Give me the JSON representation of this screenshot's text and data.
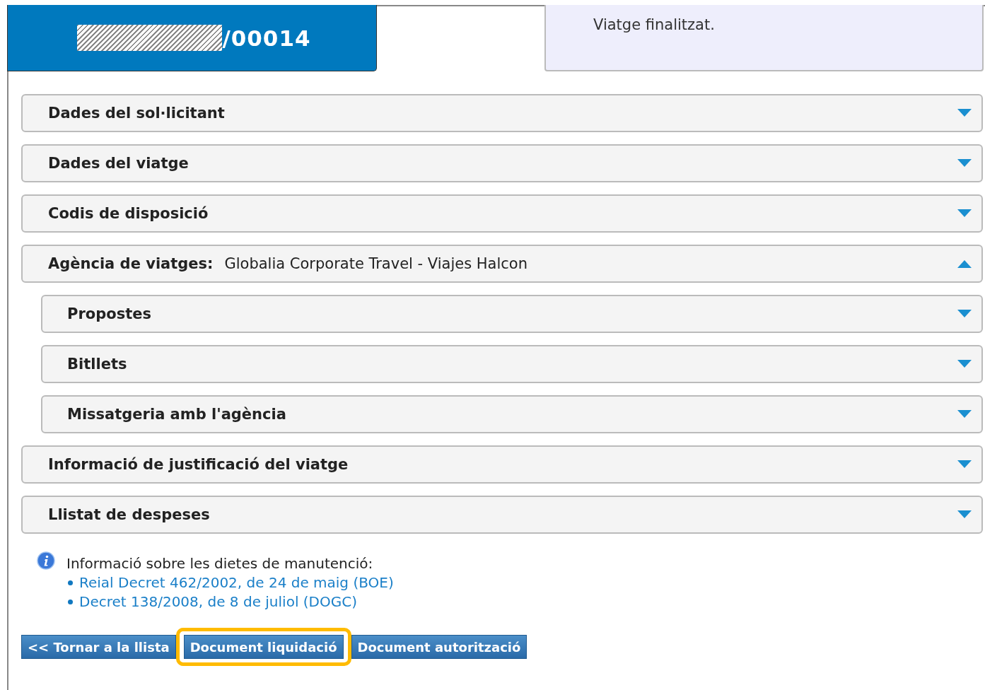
{
  "header": {
    "number": "/00014",
    "redacted": true
  },
  "status": {
    "message": "Viatge finalitzat."
  },
  "sections": [
    {
      "title": "Dades del sol·licitant",
      "expanded": false
    },
    {
      "title": "Dades del viatge",
      "expanded": false
    },
    {
      "title": "Codis de disposició",
      "expanded": false
    },
    {
      "title": "Agència de viatges:",
      "value": "Globalia Corporate Travel - Viajes Halcon",
      "expanded": true,
      "children": [
        {
          "title": "Propostes",
          "expanded": false
        },
        {
          "title": "Bitllets",
          "expanded": false
        },
        {
          "title": "Missatgeria amb l'agència",
          "expanded": false
        }
      ]
    },
    {
      "title": "Informació de justificació del viatge",
      "expanded": false
    },
    {
      "title": "Llistat de despeses",
      "expanded": false
    }
  ],
  "info": {
    "text": "Informació sobre les dietes de manutenció:",
    "links": [
      "Reial Decret 462/2002, de 24 de maig (BOE)",
      "Decret 138/2008, de 8 de juliol (DOGC)"
    ]
  },
  "buttons": [
    {
      "label": "<< Tornar a la llista",
      "highlighted": false
    },
    {
      "label": "Document liquidació",
      "highlighted": true
    },
    {
      "label": "Document autorització",
      "highlighted": false
    }
  ]
}
